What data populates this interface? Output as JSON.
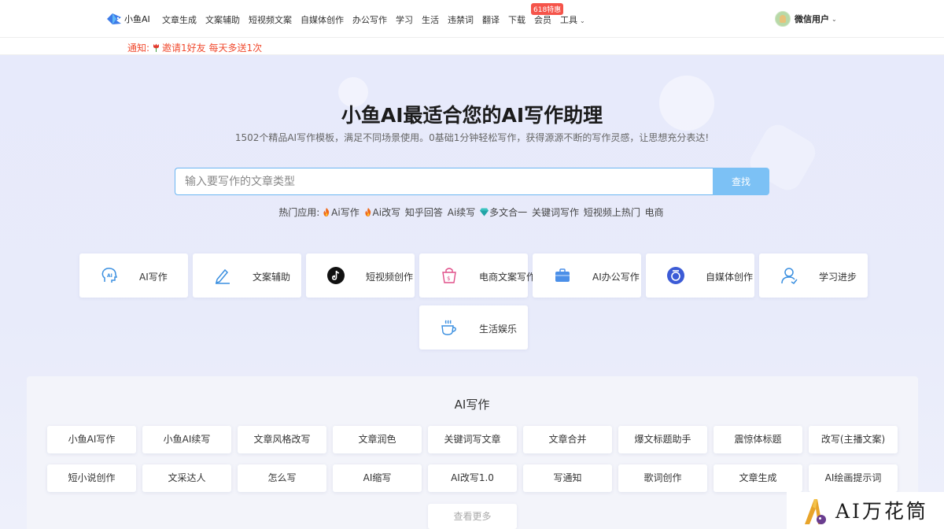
{
  "header": {
    "logo_text": "小鱼AI",
    "nav": [
      {
        "label": "文章生成"
      },
      {
        "label": "文案辅助"
      },
      {
        "label": "短视频文案"
      },
      {
        "label": "自媒体创作"
      },
      {
        "label": "办公写作"
      },
      {
        "label": "学习"
      },
      {
        "label": "生活"
      },
      {
        "label": "违禁词"
      },
      {
        "label": "翻译"
      },
      {
        "label": "下载"
      },
      {
        "label": "会员",
        "badge": "618特惠"
      },
      {
        "label": "工具"
      }
    ],
    "user_name": "微信用户"
  },
  "notice": {
    "prefix": "通知:",
    "text": "邀请1好友 每天多送1次"
  },
  "hero": {
    "title": "小鱼AI最适合您的AI写作助理",
    "subtitle": "1502个精品AI写作模板，满足不同场景使用。0基础1分钟轻松写作，获得源源不断的写作灵感，让思想充分表达!",
    "search_placeholder": "输入要写作的文章类型",
    "search_button": "查找",
    "hot_label": "热门应用:",
    "hot_items": [
      {
        "label": "Ai写作",
        "icon": "fire-icon"
      },
      {
        "label": "Ai改写",
        "icon": "fire-icon"
      },
      {
        "label": "知乎回答",
        "icon": ""
      },
      {
        "label": "Ai续写",
        "icon": ""
      },
      {
        "label": "多文合一",
        "icon": "diamond-icon"
      },
      {
        "label": "关键词写作",
        "icon": ""
      },
      {
        "label": "短视频上热门",
        "icon": ""
      },
      {
        "label": "电商",
        "icon": ""
      }
    ]
  },
  "categories": [
    {
      "label": "AI写作",
      "icon": "ai-head-icon"
    },
    {
      "label": "文案辅助",
      "icon": "pen-icon"
    },
    {
      "label": "短视频创作",
      "icon": "tiktok-icon"
    },
    {
      "label": "电商文案写作",
      "icon": "shopping-bag-icon"
    },
    {
      "label": "AI办公写作",
      "icon": "briefcase-icon"
    },
    {
      "label": "自媒体创作",
      "icon": "media-icon"
    },
    {
      "label": "学习进步",
      "icon": "person-icon"
    },
    {
      "label": "生活娱乐",
      "icon": "coffee-cup-icon"
    }
  ],
  "section": {
    "title": "AI写作",
    "tools_row1": [
      "小鱼AI写作",
      "小鱼AI续写",
      "文章风格改写",
      "文章润色",
      "关键词写文章",
      "文章合并",
      "爆文标题助手",
      "震惊体标题",
      "改写(主播文案)"
    ],
    "tools_row2": [
      "短小说创作",
      "文采达人",
      "怎么写",
      "AI缩写",
      "AI改写1.0",
      "写通知",
      "歌词创作",
      "文章生成",
      "AI绘画提示词"
    ],
    "more": "查看更多"
  },
  "watermark": {
    "text": "AI万花筒"
  },
  "colors": {
    "accent": "#7cc1f5",
    "notice": "#f04a2e",
    "badge": "#f5544a",
    "search_border": "#6cb6f2"
  }
}
